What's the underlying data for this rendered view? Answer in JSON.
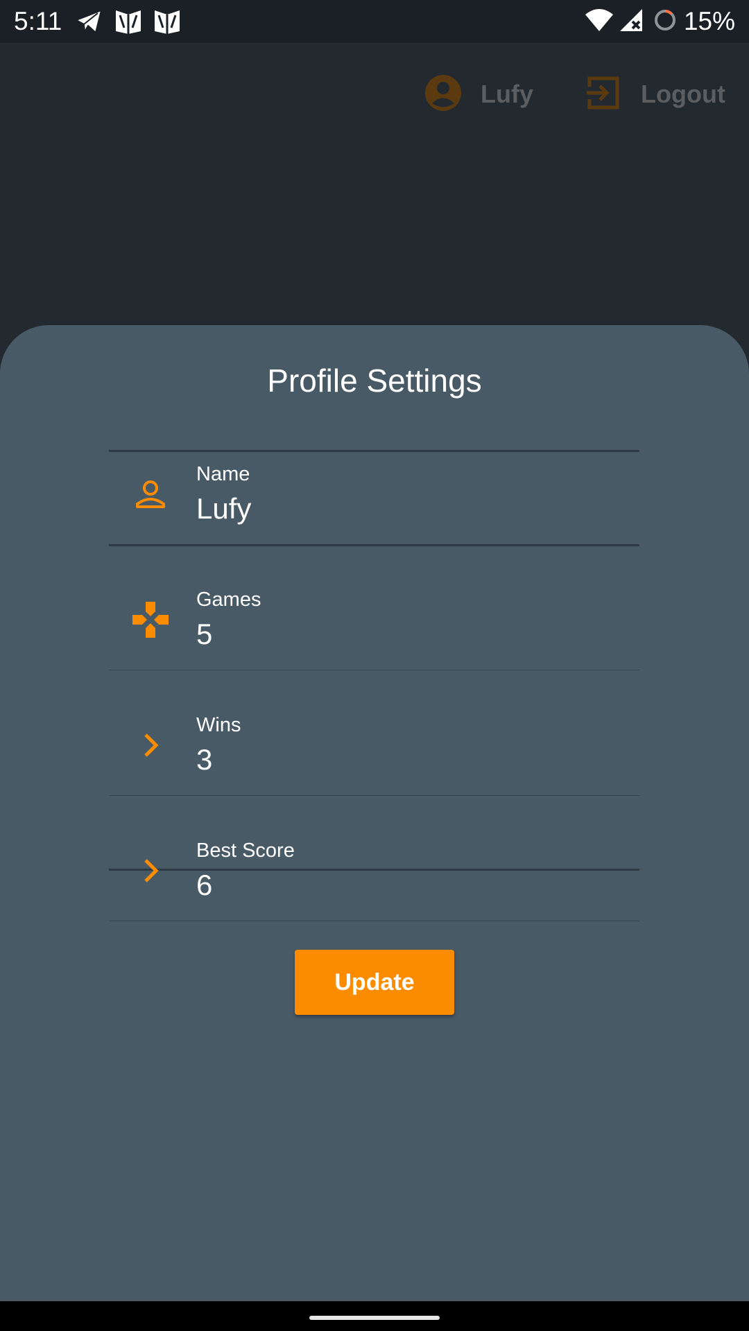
{
  "status_bar": {
    "time": "5:11",
    "battery": "15%",
    "icons": [
      "telegram-icon",
      "app-icon",
      "app-icon",
      "wifi-icon",
      "signal-icon",
      "battery-icon"
    ]
  },
  "header": {
    "user_name": "Lufy",
    "logout_label": "Logout"
  },
  "profile": {
    "title": "Profile Settings",
    "fields": [
      {
        "label": "Name",
        "value": "Lufy",
        "icon": "person-icon"
      },
      {
        "label": "Games",
        "value": "5",
        "icon": "gamepad-icon"
      },
      {
        "label": "Wins",
        "value": "3",
        "icon": "chevron-right-icon"
      },
      {
        "label": "Best Score",
        "value": "6",
        "icon": "chevron-right-icon"
      }
    ],
    "update_label": "Update"
  },
  "colors": {
    "accent": "#fb8c00",
    "sheet_background": "#485a66",
    "page_background": "#22292f"
  }
}
